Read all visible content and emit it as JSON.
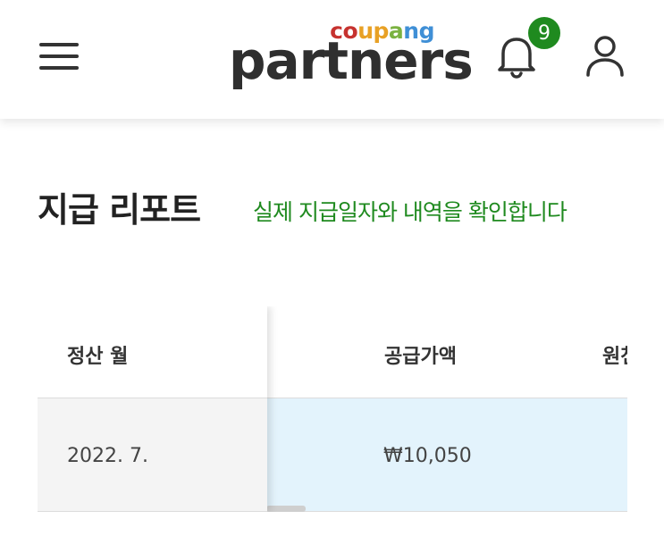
{
  "header": {
    "menu_icon": "hamburger-menu-icon",
    "logo": {
      "brand": "coupang",
      "word": "partners",
      "brand_colors": [
        "#c6322f",
        "#c6322f",
        "#e8a125",
        "#e8a125",
        "#7bb241",
        "#3f8fd6",
        "#3f8fd6"
      ]
    },
    "notification_icon": "bell-icon",
    "notification_count": "9",
    "user_icon": "user-icon",
    "accent_color": "#1f8a1f"
  },
  "page": {
    "title": "지급 리포트",
    "subtitle": "실제 지급일자와 내역을 확인합니다"
  },
  "table": {
    "columns": [
      "정산 월",
      "공급가액",
      "원천"
    ],
    "rows": [
      {
        "settlement_month": "2022. 7.",
        "supply_amount": "₩10,050"
      }
    ],
    "row_highlight_color": "#e3f3fc"
  }
}
